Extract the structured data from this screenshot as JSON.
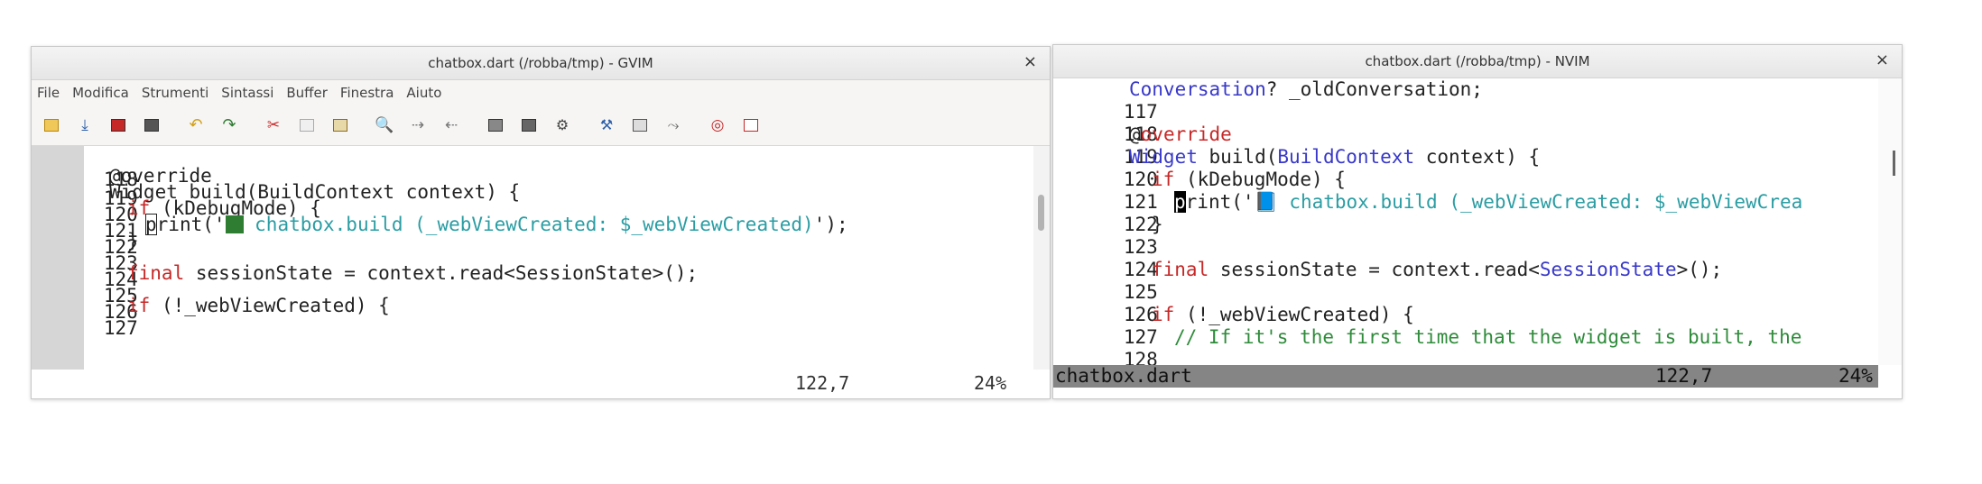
{
  "gvim": {
    "title": "chatbox.dart (/robba/tmp) - GVIM",
    "close_glyph": "×",
    "menu": [
      "File",
      "Modifica",
      "Strumenti",
      "Sintassi",
      "Buffer",
      "Finestra",
      "Aiuto"
    ],
    "toolbar_icons": [
      "open-icon",
      "save-to-icon",
      "save-icon",
      "save-all-icon",
      "undo-icon",
      "redo-icon",
      "cut-icon",
      "copy-icon",
      "paste-icon",
      "find-replace-icon",
      "find-next-icon",
      "find-prev-icon",
      "load-session-icon",
      "save-session-icon",
      "run-script-icon",
      "make-icon",
      "shell-icon",
      "tag-jump-icon",
      "help-icon",
      "find-help-icon"
    ],
    "lines": [
      {
        "num": "118",
        "text": ""
      },
      {
        "num": "119",
        "text": "@override"
      },
      {
        "num": "120",
        "text": "Widget build(BuildContext context) {"
      },
      {
        "num": "121",
        "kw": "if",
        "rest": " (kDebugMode) {"
      },
      {
        "num": "122",
        "cursor_char": "p",
        "pre": "rint('",
        "post": " chatbox.build (_webViewCreated: $_webViewCreated)",
        "tail": "');"
      },
      {
        "num": "123",
        "text": "}"
      },
      {
        "num": "124",
        "text": ""
      },
      {
        "num": "125",
        "kw": "final",
        "rest": " sessionState = context.read<SessionState>();"
      },
      {
        "num": "126",
        "text": ""
      },
      {
        "num": "127",
        "kw": "if",
        "rest": " (!_webViewCreated) {"
      }
    ],
    "status": {
      "position": "122,7",
      "percent": "24%"
    }
  },
  "nvim": {
    "title": "chatbox.dart (/robba/tmp) - NVIM",
    "close_glyph": "×",
    "lines": [
      {
        "num": "117",
        "type": "Conversation",
        "rest": "? _oldConversation;"
      },
      {
        "num": "118",
        "text": ""
      },
      {
        "num": "119",
        "annot_at": "@",
        "annot": "override"
      },
      {
        "num": "120",
        "type": "Widget",
        "rest": " build(",
        "type2": "BuildContext",
        "rest2": " context) {"
      },
      {
        "num": "121",
        "kw": "if",
        "rest": " (kDebugMode) {"
      },
      {
        "num": "122",
        "cursor_char": "p",
        "pre": "rint('",
        "emoji": "📘",
        "post": " chatbox.build (_webViewCreated: $_webViewCrea"
      },
      {
        "num": "123",
        "text": "}"
      },
      {
        "num": "124",
        "text": ""
      },
      {
        "num": "125",
        "kw": "final",
        "rest": " sessionState = context.read<",
        "type": "SessionState",
        "rest2": ">();"
      },
      {
        "num": "126",
        "text": ""
      },
      {
        "num": "127",
        "kw": "if",
        "rest": " (!_webViewCreated) {"
      },
      {
        "num": "128",
        "comment": "// If it's the first time that the widget is built, the"
      }
    ],
    "status": {
      "file": "chatbox.dart",
      "position": "122,7",
      "percent": "24%"
    }
  }
}
